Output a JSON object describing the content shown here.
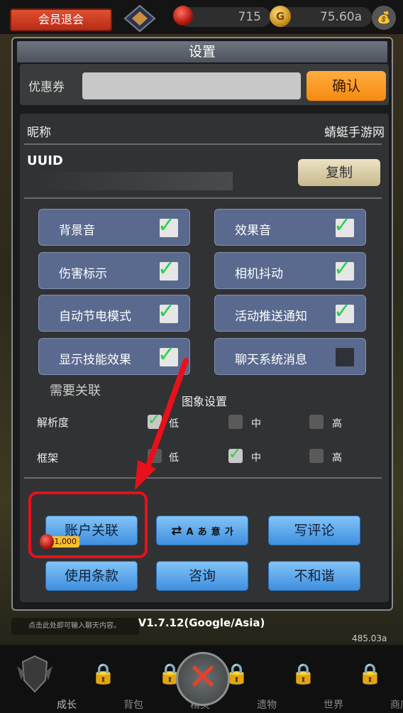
{
  "topbar": {
    "member_exit_label": "会员退会",
    "gem_count": "715",
    "coin_amount": "75.60a",
    "coin_symbol": "G"
  },
  "panel": {
    "title": "设置",
    "coupon": {
      "label": "优惠券",
      "value": "",
      "confirm_label": "确认"
    },
    "nickname": {
      "label": "昵称",
      "value": "蜻蜓手游网"
    },
    "uuid": {
      "label": "UUID",
      "copy_label": "复制"
    },
    "options": [
      {
        "label": "背景音",
        "checked": true
      },
      {
        "label": "效果音",
        "checked": true
      },
      {
        "label": "伤害标示",
        "checked": true
      },
      {
        "label": "相机抖动",
        "checked": true
      },
      {
        "label": "自动节电模式",
        "checked": true
      },
      {
        "label": "活动推送通知",
        "checked": true
      },
      {
        "label": "显示技能效果",
        "checked": true
      },
      {
        "label": "聊天系统消息",
        "checked": false
      }
    ],
    "graphics": {
      "title": "图象设置",
      "rows": [
        {
          "label": "解析度",
          "choices": [
            "低",
            "中",
            "高"
          ],
          "selected": "低"
        },
        {
          "label": "框架",
          "choices": [
            "低",
            "中",
            "高"
          ],
          "selected": "中"
        }
      ]
    },
    "account": {
      "need_link_label": "需要关联",
      "link_label": "账户关联",
      "reward_badge": "1,000",
      "language_glyphs": [
        "A",
        "あ",
        "意",
        "가"
      ],
      "review_label": "写评论",
      "terms_label": "使用条款",
      "consult_label": "咨询",
      "report_label": "不和谐"
    }
  },
  "version": "V1.7.12(Google/Asia)",
  "chat_placeholder": "点击此处即可输入聊天内容。",
  "power_value": "485.03a",
  "bottom_tabs": [
    {
      "label": "成长",
      "locked": false
    },
    {
      "label": "背包",
      "locked": true
    },
    {
      "label": "精灵",
      "locked": true
    },
    {
      "label": "遗物",
      "locked": true
    },
    {
      "label": "世界",
      "locked": true
    },
    {
      "label": "商店",
      "locked": true
    }
  ],
  "colors": {
    "confirm": "#f58a10",
    "option_bg": "#5a6a8e",
    "account_button": "#3f8fde",
    "highlight": "#e8101a"
  }
}
